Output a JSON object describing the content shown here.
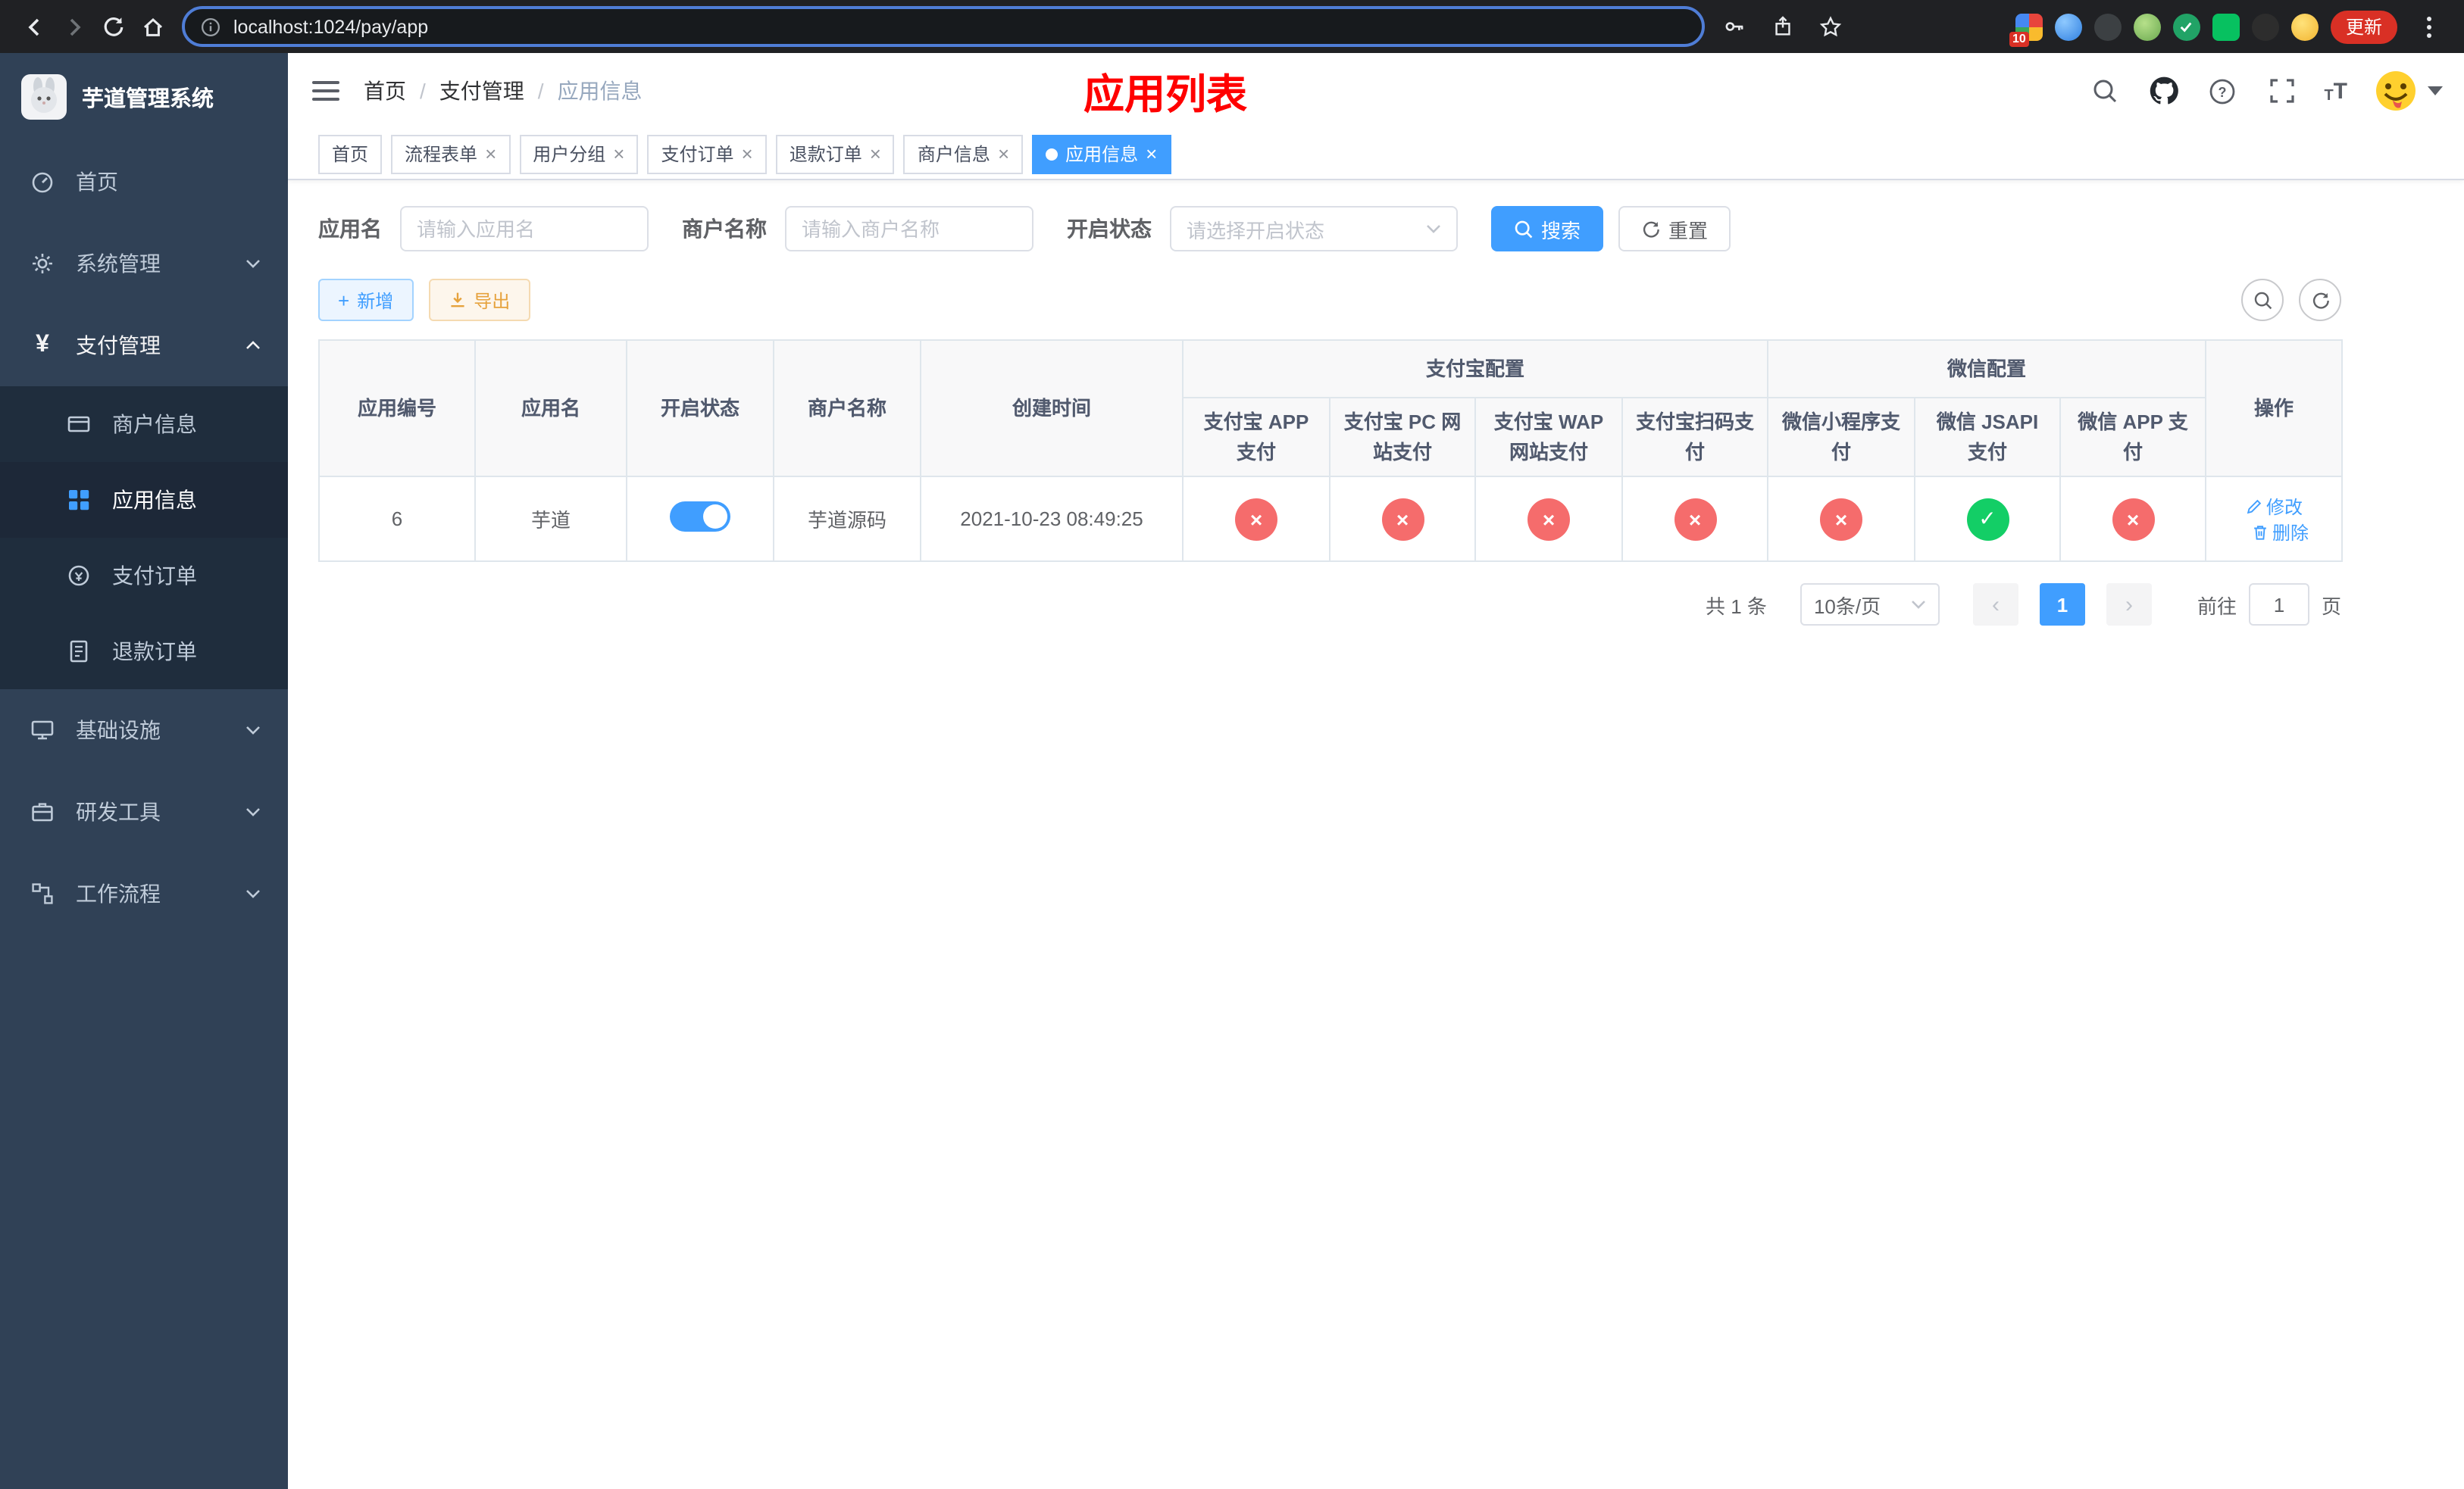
{
  "colors": {
    "accent": "#409eff",
    "danger": "#f56c6c",
    "success": "#13ce66",
    "warning": "#e6a23c",
    "page_title_red": "#ff0000",
    "sidebar_bg": "#304156",
    "submenu_bg": "#1f2d3d"
  },
  "browser": {
    "url": "localhost:1024/pay/app",
    "update_label": "更新",
    "extension_badge": "10"
  },
  "sidebar": {
    "title": "芋道管理系统",
    "items": [
      {
        "label": "首页"
      },
      {
        "label": "系统管理"
      },
      {
        "label": "支付管理"
      },
      {
        "label": "商户信息"
      },
      {
        "label": "应用信息"
      },
      {
        "label": "支付订单"
      },
      {
        "label": "退款订单"
      },
      {
        "label": "基础设施"
      },
      {
        "label": "研发工具"
      },
      {
        "label": "工作流程"
      }
    ]
  },
  "navbar": {
    "breadcrumb": {
      "home": "首页",
      "section": "支付管理",
      "current": "应用信息",
      "separator": "/"
    },
    "page_title": "应用列表"
  },
  "tabs": {
    "items": [
      {
        "label": "首页"
      },
      {
        "label": "流程表单"
      },
      {
        "label": "用户分组"
      },
      {
        "label": "支付订单"
      },
      {
        "label": "退款订单"
      },
      {
        "label": "商户信息"
      },
      {
        "label": "应用信息"
      }
    ]
  },
  "filters": {
    "app_name_label": "应用名",
    "app_name_placeholder": "请输入应用名",
    "merchant_label": "商户名称",
    "merchant_placeholder": "请输入商户名称",
    "status_label": "开启状态",
    "status_placeholder": "请选择开启状态",
    "search_label": "搜索",
    "reset_label": "重置"
  },
  "toolbar": {
    "add_label": "新增",
    "export_label": "导出"
  },
  "table": {
    "columns": {
      "app_id": "应用编号",
      "app_name": "应用名",
      "status": "开启状态",
      "merchant": "商户名称",
      "created": "创建时间",
      "alipay_group": "支付宝配置",
      "wechat_group": "微信配置",
      "alipay_app": "支付宝 APP 支付",
      "alipay_pc": "支付宝 PC 网站支付",
      "alipay_wap": "支付宝 WAP 网站支付",
      "alipay_qr": "支付宝扫码支付",
      "wx_mini": "微信小程序支付",
      "wx_jsapi": "微信 JSAPI 支付",
      "wx_app": "微信 APP 支付",
      "actions": "操作"
    },
    "row": {
      "app_id": "6",
      "app_name": "芋道",
      "enabled": true,
      "merchant": "芋道源码",
      "created": "2021-10-23 08:49:25",
      "statuses": {
        "alipay_app": false,
        "alipay_pc": false,
        "alipay_wap": false,
        "alipay_qr": false,
        "wx_mini": false,
        "wx_jsapi": true,
        "wx_app": false
      },
      "edit_label": "修改",
      "delete_label": "删除"
    }
  },
  "pagination": {
    "total_label": "共 1 条",
    "page_size": "10条/页",
    "current_page": "1",
    "goto_label": "前往",
    "goto_value": "1",
    "unit_label": "页"
  }
}
